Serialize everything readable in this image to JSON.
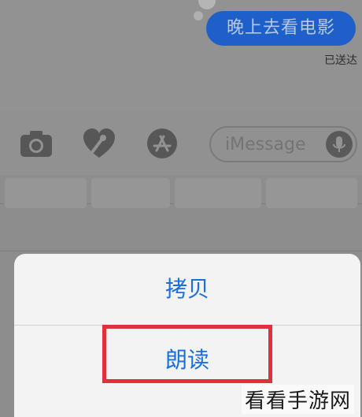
{
  "chat": {
    "message_text": "晚上去看电影",
    "status_text": "已送达"
  },
  "toolbar": {
    "camera_icon": "camera-icon",
    "digital_touch_icon": "digital-touch-heart-icon",
    "app_store_icon": "app-store-icon",
    "input_placeholder": "iMessage",
    "mic_icon": "microphone-icon"
  },
  "action_sheet": {
    "copy_label": "拷贝",
    "speak_label": "朗读"
  },
  "watermark": {
    "text": "看看手游网"
  },
  "colors": {
    "bubble_blue": "#1e5fc9",
    "action_text_blue": "#1a6fe0",
    "highlight_red": "#e0303b"
  }
}
